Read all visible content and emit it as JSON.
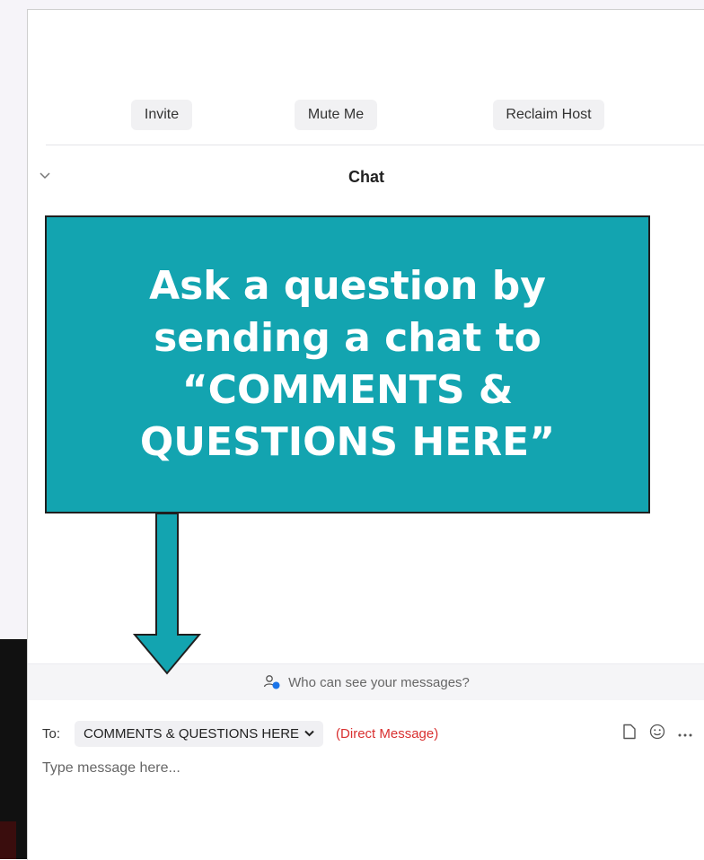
{
  "toolbar": {
    "invite_label": "Invite",
    "mute_label": "Mute Me",
    "reclaim_label": "Reclaim Host"
  },
  "chat": {
    "title": "Chat",
    "who_can_see": "Who can see your messages?",
    "to_label": "To:",
    "recipient": "COMMENTS & QUESTIONS HERE",
    "direct_message": "(Direct Message)",
    "placeholder": "Type message here..."
  },
  "callout": {
    "line1": "Ask a question by",
    "line2": "sending a chat to",
    "line3": "“COMMENTS &",
    "line4": "QUESTIONS HERE”"
  },
  "colors": {
    "callout_bg": "#13a4b0",
    "direct_message": "#d93030"
  },
  "icons": [
    "chevron-down-icon",
    "people-icon",
    "file-icon",
    "emoji-icon",
    "more-icon"
  ]
}
